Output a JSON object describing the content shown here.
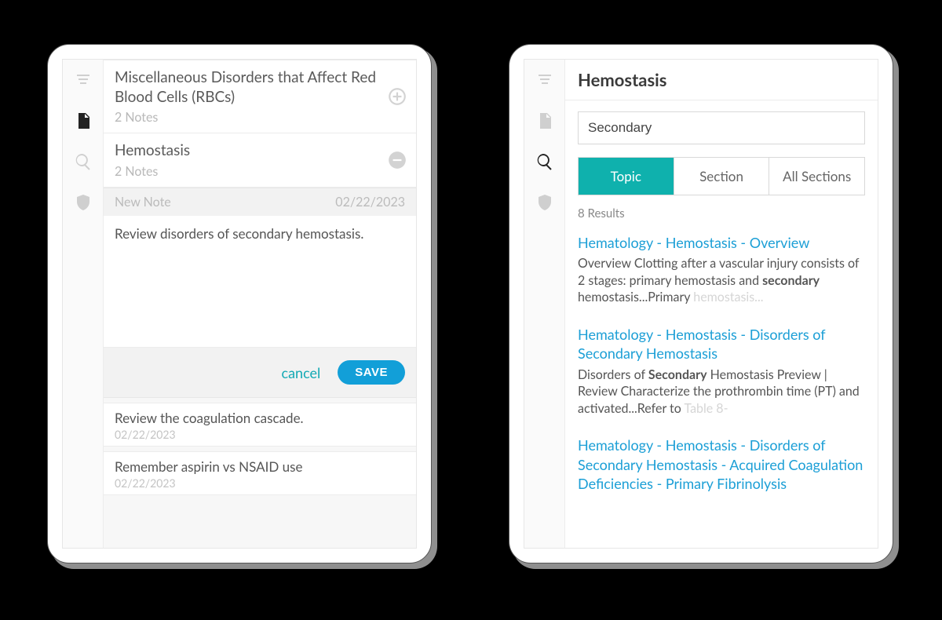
{
  "left": {
    "sections": [
      {
        "title": "Miscellaneous Disorders that Affect Red Blood Cells (RBCs)",
        "sub": "2 Notes"
      },
      {
        "title": "Hemostasis",
        "sub": "2 Notes"
      }
    ],
    "newnote_label": "New Note",
    "newnote_date": "02/22/2023",
    "editor_text": "Review disorders of secondary hemostasis.",
    "cancel_label": "cancel",
    "save_label": "SAVE",
    "notes": [
      {
        "text": "Review the coagulation cascade.",
        "date": "02/22/2023"
      },
      {
        "text": "Remember aspirin vs NSAID use",
        "date": "02/22/2023"
      }
    ]
  },
  "right": {
    "title": "Hemostasis",
    "search_value": "Secondary",
    "scopes": [
      "Topic",
      "Section",
      "All Sections"
    ],
    "active_scope": 0,
    "results_count": "8 Results",
    "results": [
      {
        "title": "Hematology - Hemostasis - Overview",
        "snippet_pre": "Overview Clotting after a vascular injury consists of 2 stages: primary hemostasis and ",
        "snippet_bold": "secondary",
        "snippet_post": " hemostasis...Primary ",
        "snippet_fade": "hemostasis..."
      },
      {
        "title": "Hematology - Hemostasis - Disorders of Secondary Hemostasis",
        "snippet_pre": "Disorders of ",
        "snippet_bold": "Secondary",
        "snippet_post": " Hemostasis Preview | Review Characterize the prothrombin time (PT) and activated...Refer to ",
        "snippet_fade": "Table 8-"
      },
      {
        "title": "Hematology - Hemostasis - Disorders of Secondary Hemostasis - Acquired Coagulation Deficiencies - Primary Fibrinolysis",
        "snippet_pre": "",
        "snippet_bold": "",
        "snippet_post": "",
        "snippet_fade": ""
      }
    ]
  }
}
